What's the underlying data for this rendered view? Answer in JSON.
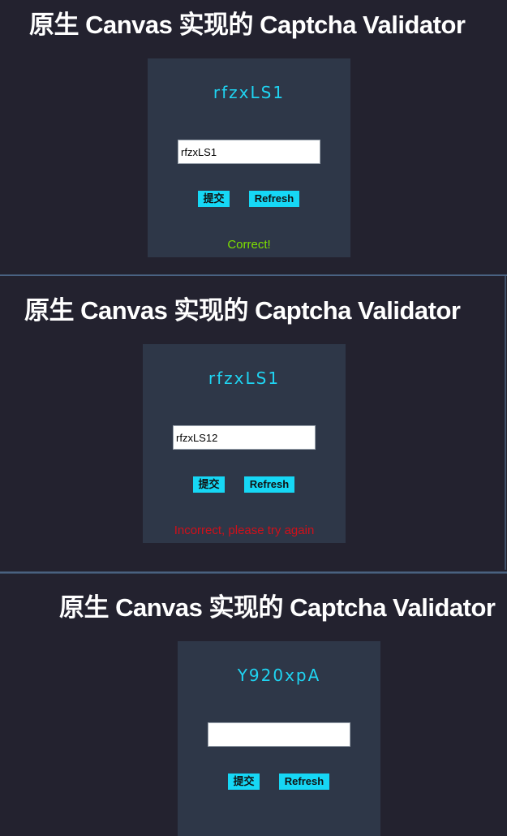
{
  "colors": {
    "background": "#23222f",
    "card": "#2e3748",
    "captcha_text": "#1fd4f2",
    "button": "#16d7f5",
    "success": "#7ee000",
    "error": "#d0101a"
  },
  "panels": [
    {
      "title": "原生 Canvas 实现的 Captcha Validator",
      "captcha_text": "rfzxLS1",
      "input_value": "rfzxLS1",
      "submit_label": "提交",
      "refresh_label": "Refresh",
      "message": "Correct!",
      "message_status": "success"
    },
    {
      "title": "原生 Canvas 实现的 Captcha Validator",
      "captcha_text": "rfzxLS1",
      "input_value": "rfzxLS12",
      "submit_label": "提交",
      "refresh_label": "Refresh",
      "message": "Incorrect, please try again",
      "message_status": "error"
    },
    {
      "title": "原生 Canvas 实现的 Captcha Validator",
      "captcha_text": "Y920xpA",
      "input_value": "",
      "submit_label": "提交",
      "refresh_label": "Refresh",
      "message": "",
      "message_status": "none"
    }
  ]
}
